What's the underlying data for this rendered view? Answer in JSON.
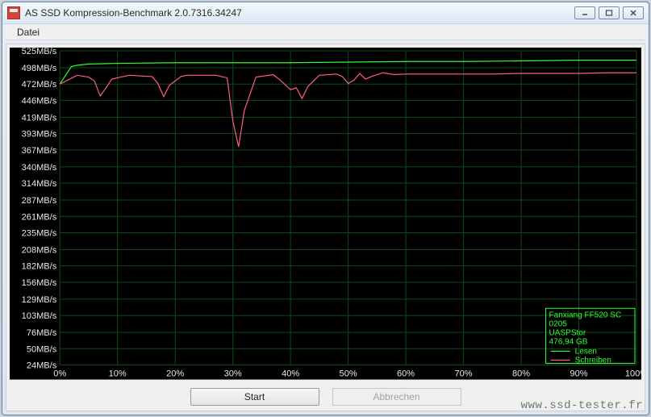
{
  "window": {
    "title": "AS SSD Kompression-Benchmark 2.0.7316.34247"
  },
  "menu": {
    "datei": "Datei"
  },
  "buttons": {
    "start": "Start",
    "abort": "Abbrechen"
  },
  "legend": {
    "device_line1": "Fanxiang FF520 SC",
    "device_line2": "0205",
    "driver": "UASPStor",
    "capacity": "476,94 GB",
    "read": "Lesen",
    "write": "Schreiben"
  },
  "watermark": "www.ssd-tester.fr",
  "chart_data": {
    "type": "line",
    "title": "",
    "xlabel": "",
    "ylabel": "",
    "x_unit": "%",
    "y_unit": "MB/s",
    "xlim": [
      0,
      100
    ],
    "ylim": [
      24,
      525
    ],
    "y_ticks": [
      525,
      498,
      472,
      446,
      419,
      393,
      367,
      340,
      314,
      287,
      261,
      235,
      208,
      182,
      156,
      129,
      103,
      76,
      50,
      24
    ],
    "x_ticks": [
      0,
      10,
      20,
      30,
      40,
      50,
      60,
      70,
      80,
      90,
      100
    ],
    "series": [
      {
        "name": "Lesen",
        "color": "#2fff2f",
        "x": [
          0,
          2,
          3,
          5,
          10,
          20,
          30,
          40,
          50,
          60,
          70,
          80,
          90,
          100
        ],
        "values": [
          472,
          500,
          502,
          504,
          505,
          506,
          506,
          506,
          507,
          508,
          508,
          509,
          510,
          510
        ]
      },
      {
        "name": "Schreiben",
        "color": "#ff5b8a",
        "x": [
          0,
          3,
          5,
          6,
          7,
          8,
          9,
          12,
          16,
          17,
          18,
          19,
          21,
          22,
          24,
          27,
          29,
          30,
          31,
          32,
          34,
          37,
          38,
          40,
          41,
          42,
          43,
          45,
          48,
          49,
          50,
          51,
          52,
          53,
          54,
          56,
          58,
          60,
          65,
          70,
          75,
          80,
          85,
          90,
          95,
          100
        ],
        "values": [
          472,
          486,
          483,
          477,
          453,
          466,
          480,
          486,
          484,
          473,
          452,
          470,
          484,
          486,
          486,
          486,
          482,
          413,
          372,
          430,
          483,
          487,
          480,
          463,
          466,
          449,
          468,
          486,
          488,
          484,
          473,
          478,
          489,
          480,
          484,
          490,
          487,
          488,
          488,
          488,
          488,
          489,
          489,
          489,
          490,
          490
        ]
      }
    ]
  }
}
